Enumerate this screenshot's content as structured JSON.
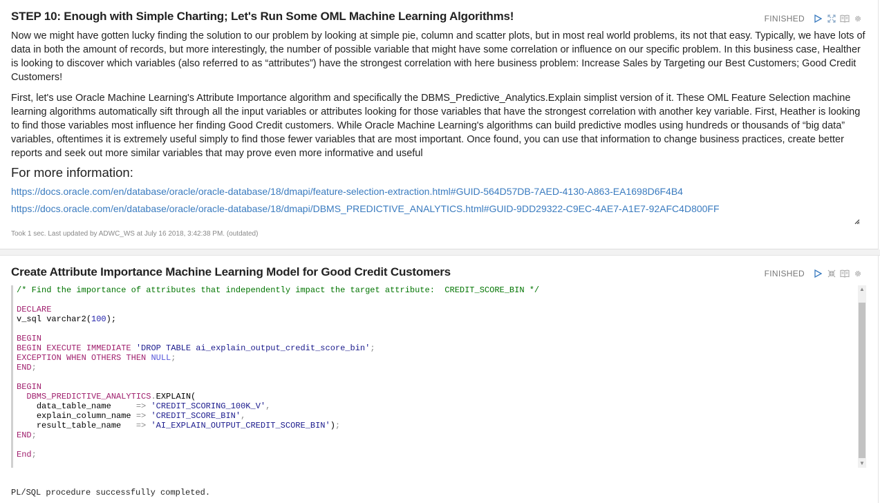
{
  "para1": {
    "title": "STEP 10: Enough with Simple Charting; Let's Run Some OML Machine Learning Algorithms!",
    "status": "FINISHED",
    "body1": "Now we might have gotten lucky finding the solution to our problem by looking at simple pie, column and scatter plots, but in most real world problems, its not that easy. Typically, we have lots of data in both the amount of records, but more interestingly, the number of possible variable that might have some correlation or influence on our specific problem. In this business case, Healther is looking to discover which variables (also referred to as “attributes”) have the strongest correlation with here business problem: Increase Sales by Targeting our Best Customers; Good Credit Customers!",
    "body2": "First, let's use Oracle Machine Learning's Attribute Importance algorithm and specifically the DBMS_Predictive_Analytics.Explain simplist version of it. These OML Feature Selection machine learning algorithms automatically sift through all the input variables or attributes looking for those variables that have the strongest correlation with another key variable. First, Heather is looking to find those variables most influence her finding Good Credit customers. While Oracle Machine Learning's algorithms can build predictive modles using hundreds or thousands of “big data” variables, oftentimes it is extremely useful simply to find those fewer variables that are most important. Once found, you can use that information to change business practices, create better reports and seek out more similar variables that may prove even more informative and useful",
    "more_info": "For more information:",
    "link1": "https://docs.oracle.com/en/database/oracle/oracle-database/18/dmapi/feature-selection-extraction.html#GUID-564D57DB-7AED-4130-A863-EA1698D6F4B4",
    "link2": "https://docs.oracle.com/en/database/oracle/oracle-database/18/dmapi/DBMS_PREDICTIVE_ANALYTICS.html#GUID-9DD29322-C9EC-4AE7-A1E7-92AFC4D800FF",
    "footer": "Took 1 sec. Last updated by ADWC_WS at July 16 2018, 3:42:38 PM. (outdated)"
  },
  "para2": {
    "title": "Create Attribute Importance Machine Learning Model for Good Credit Customers",
    "status": "FINISHED",
    "code": {
      "comment": "/* Find the importance of attributes that independently impact the target attribute:  CREDIT_SCORE_BIN */",
      "declare": "DECLARE",
      "vsql": "v_sql varchar2(",
      "vsql_num": "100",
      "vsql_end": ");",
      "begin1": "BEGIN",
      "begin2": "BEGIN EXECUTE IMMEDIATE",
      "drop_str": "'DROP TABLE ai_explain_output_credit_score_bin'",
      "exc": "EXCEPTION WHEN OTHERS THEN",
      "null": "NULL",
      "end1": "END",
      "begin3": "BEGIN",
      "pkg": "DBMS_PREDICTIVE_ANALYTICS",
      "explain": "EXPLAIN(",
      "p1": "data_table_name",
      "p1v": "'CREDIT_SCORING_100K_V'",
      "p2": "explain_column_name",
      "p2v": "'CREDIT_SCORE_BIN'",
      "p3": "result_table_name",
      "p3v": "'AI_EXPLAIN_OUTPUT_CREDIT_SCORE_BIN'",
      "end2": "END",
      "end3": "End"
    },
    "result": "PL/SQL procedure successfully completed."
  },
  "icons": [
    "play-icon",
    "expand-icon",
    "book-icon",
    "gear-icon",
    "resize-handle-icon"
  ],
  "colors": {
    "accent": "#3a7bbf",
    "keyword": "#a0206e",
    "comment": "#007400"
  }
}
